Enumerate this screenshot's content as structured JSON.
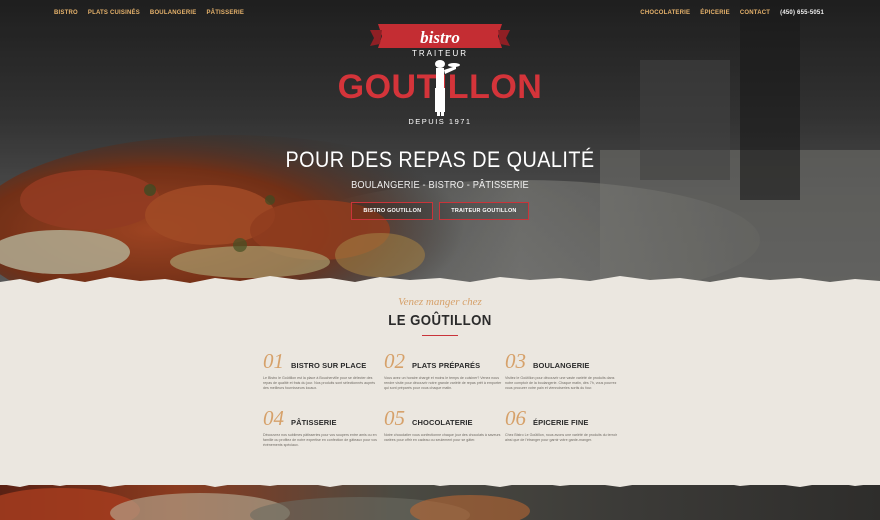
{
  "nav_left": [
    {
      "label": "BISTRO"
    },
    {
      "label": "PLATS CUISINÉS"
    },
    {
      "label": "BOULANGERIE"
    },
    {
      "label": "PÂTISSERIE"
    }
  ],
  "nav_right": [
    {
      "label": "CHOCOLATERIE"
    },
    {
      "label": "ÉPICERIE"
    },
    {
      "label": "CONTACT"
    },
    {
      "label": "(450) 655-5051"
    }
  ],
  "logo": {
    "banner": "bistro",
    "sub": "TRAITEUR",
    "name": "GOUTILLON",
    "since": "DEPUIS 1971"
  },
  "hero": {
    "headline": "POUR DES REPAS DE QUALITÉ",
    "subline": "BOULANGERIE - BISTRO - PÂTISSERIE",
    "buttons": [
      {
        "label": "BISTRO GOUTILLON"
      },
      {
        "label": "TRAITEUR GOUTILLON"
      }
    ]
  },
  "intro": {
    "eyebrow": "Venez manger chez",
    "title": "LE GOÛTILLON"
  },
  "features": [
    {
      "num": "01",
      "title": "BISTRO SUR PLACE",
      "desc": "Le Bistro le Goûtillon est la place à Boucherville pour se délecter des repas de qualité et frais du jour. Nos produits sont sélectionnés auprès des meilleurs fournisseurs locaux."
    },
    {
      "num": "02",
      "title": "PLATS PRÉPARÉS",
      "desc": "Vous avez un horaire chargé et moins le temps de cuisiner? Venez nous rendre visite pour découvrir notre grande variété de repas prêt à emporter qui sont préparés pour vous chaque matin."
    },
    {
      "num": "03",
      "title": "BOULANGERIE",
      "desc": "Visitez le Goûtillon pour découvrir une vaste variété de produits dans notre comptoir de la boulangerie. Chaque matin, dès 7h, vous pourrez vous procurer votre pain et viennoiseries sortis du four."
    },
    {
      "num": "04",
      "title": "PÂTISSERIE",
      "desc": "Découvrez nos sublimes pâtisseries pour vos soupers entre amis ou en famille ou profitez de notre expertise en confection de gâteaux pour vos événements spéciaux."
    },
    {
      "num": "05",
      "title": "CHOCOLATERIE",
      "desc": "Notre chocolatier vous confectionne chaque jour des chocolats à saveurs variées pour offrir en cadeau ou seulement pour se gâter."
    },
    {
      "num": "06",
      "title": "ÉPICERIE FINE",
      "desc": "Chez Bistro Le Goûtillon, nous avons une variété de produits du terroir ainsi que de l'étranger pour garnir votre garde-manger."
    }
  ],
  "colors": {
    "accent_gold": "#d6a16a",
    "brand_red": "#c9343a",
    "paper": "#ebe7e0"
  }
}
